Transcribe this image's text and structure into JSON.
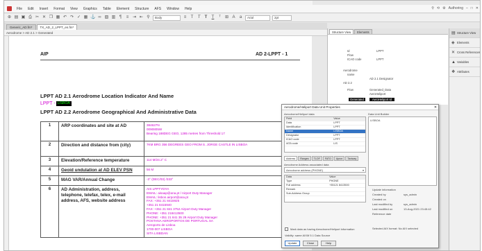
{
  "menubar": {
    "logo": "app-logo",
    "items": [
      "File",
      "Edit",
      "Insert",
      "Format",
      "View",
      "Graphics",
      "Table",
      "Element",
      "Structure",
      "AFS",
      "Window",
      "Help"
    ],
    "search_icon": "search-icon",
    "workspace": "Authoring"
  },
  "toolbar": {
    "style_combo": "Body",
    "font_combo": "Arial",
    "size_combo": "2pt"
  },
  "tabs": [
    {
      "label": "Generic_AD.fm*"
    },
    {
      "label": "TX_AD_2_LPPT_en.fm*"
    }
  ],
  "breadcrumb": "Aerodrome  >  AD 2.1  >  Generated",
  "document": {
    "header_left": "AIP",
    "header_right": "AD 2-LPPT - 1",
    "section1_title": "LPPT AD 2.1 Aerodrome Location Indicator And Name",
    "indicator_prefix": "LPPT -",
    "indicator_value": "LISBOA",
    "section2_title": "LPPT AD 2.2 Aerodrome Geographical And Administrative Data",
    "rows": [
      {
        "num": "1",
        "desc": "ARP coordinates and site at AD",
        "vals": [
          "384627N",
          "0090805W",
          "Bearing 188DEG GEO, 1285 metres from Threshold 17"
        ]
      },
      {
        "num": "2",
        "desc": "Direction and distance from (city)",
        "vals": [
          "7KM BRG 356 DEGREES GEO FROM S. JORGE CASTLE IN LISBOA"
        ]
      },
      {
        "num": "3",
        "desc": "Elevation/Reference temperature",
        "vals": [
          "114 M/24.2° C"
        ]
      },
      {
        "num": "4",
        "desc": "Geoid undulation at AD ELEV PSN",
        "vals": [
          "56 M"
        ]
      },
      {
        "num": "5",
        "desc": "MAG VAR/Annual Change",
        "vals": [
          "-3° (DEC/03) /333°"
        ]
      },
      {
        "num": "6",
        "desc": "AD Administration, address, telephone, telefax, telex, e-mail address, AFS, website address",
        "vals": [
          "AIS LPPTYDYA",
          "EMAIL: aisaap@ana.pt / Airport Duty Manager",
          "EMAIL: lisbon.airport@ana.pt",
          "FAX: +351 21 8415925",
          "+351 21 8415940",
          "FAX: +351 21 841 3752 Airport Duty Manager",
          "PHONE: +351 218413500",
          "PHONE: +351 21 841 35 29 Airport Duty Manager",
          "POSTANA AEROPORTOS DE PORTUGAL SA",
          "Aeroporto de Lisboa",
          "1700-007 LISBOA",
          "SITA LISBDAN"
        ]
      }
    ]
  },
  "structure": {
    "tabs": [
      "Structure View",
      "Elements"
    ],
    "nodes": [
      "Id",
      "Flow",
      "ICAO code",
      "Aerodrome",
      "name",
      "LPPT",
      "LPPT",
      "AD 2.1 Designator",
      "AD 2.2",
      "Flow",
      "AeroHeliport",
      "Generated_Data"
    ],
    "selected_node": "Generated",
    "selected_detail": "AeroHeliport Id"
  },
  "sidebar": {
    "items": [
      {
        "label": "Structure View",
        "icon": "tree-icon"
      },
      {
        "label": "Elements",
        "icon": "element-icon"
      },
      {
        "label": "Cross References",
        "icon": "crossref-icon"
      },
      {
        "label": "Variables",
        "icon": "variable-icon"
      },
      {
        "label": "Attributes",
        "icon": "attribute-icon"
      }
    ]
  },
  "dialog": {
    "title": "Aerodrome/Heliport Data Unit Properties",
    "left_label": "Aerodrome/Heliport data",
    "right_label": "Data Unit Builder",
    "cols": [
      "Field",
      "Value"
    ],
    "fields": [
      [
        "Data",
        "LPPT"
      ],
      [
        "Identification",
        "LPPT"
      ],
      [
        "Name",
        "LISBOA"
      ],
      [
        "Designator",
        "LPPT"
      ],
      [
        "ICAO code",
        "LPPT"
      ],
      [
        "IATA code",
        "LIS"
      ]
    ],
    "selected_field": "Name",
    "preview_value": "LISBOA",
    "tabs": [
      "Address",
      "Ranges",
      "TLOF",
      "FATO",
      "Apron",
      "Taxiway"
    ],
    "assoc_label": "Aerodrome Address associated data",
    "assoc_combo": "Aerodrome address (PHONE)",
    "assoc_rows": [
      [
        "Data",
        "Value"
      ],
      [
        "Type",
        "PHONE"
      ],
      [
        "Full address",
        "+35121 8413500"
      ],
      [
        "Remark",
        ""
      ],
      [
        "Sub-Address Group",
        ""
      ]
    ],
    "info_label": "Update information",
    "info": [
      [
        "Created by",
        "sys_admin"
      ],
      [
        "Created on",
        ""
      ],
      [
        "Last modified by",
        "sys_admin"
      ],
      [
        "Last modified on",
        "13-Aug-2021 23:45:42"
      ],
      [
        "Reference date",
        ""
      ]
    ],
    "selected_format": "Selected AIX format:  No AIX selected",
    "checkbox_label": "Mark data as having Aerodrome/Heliport information",
    "validity": "Validity: same AIXM 5.1 Data Source",
    "buttons": [
      "Update",
      "Close",
      "Help"
    ]
  }
}
